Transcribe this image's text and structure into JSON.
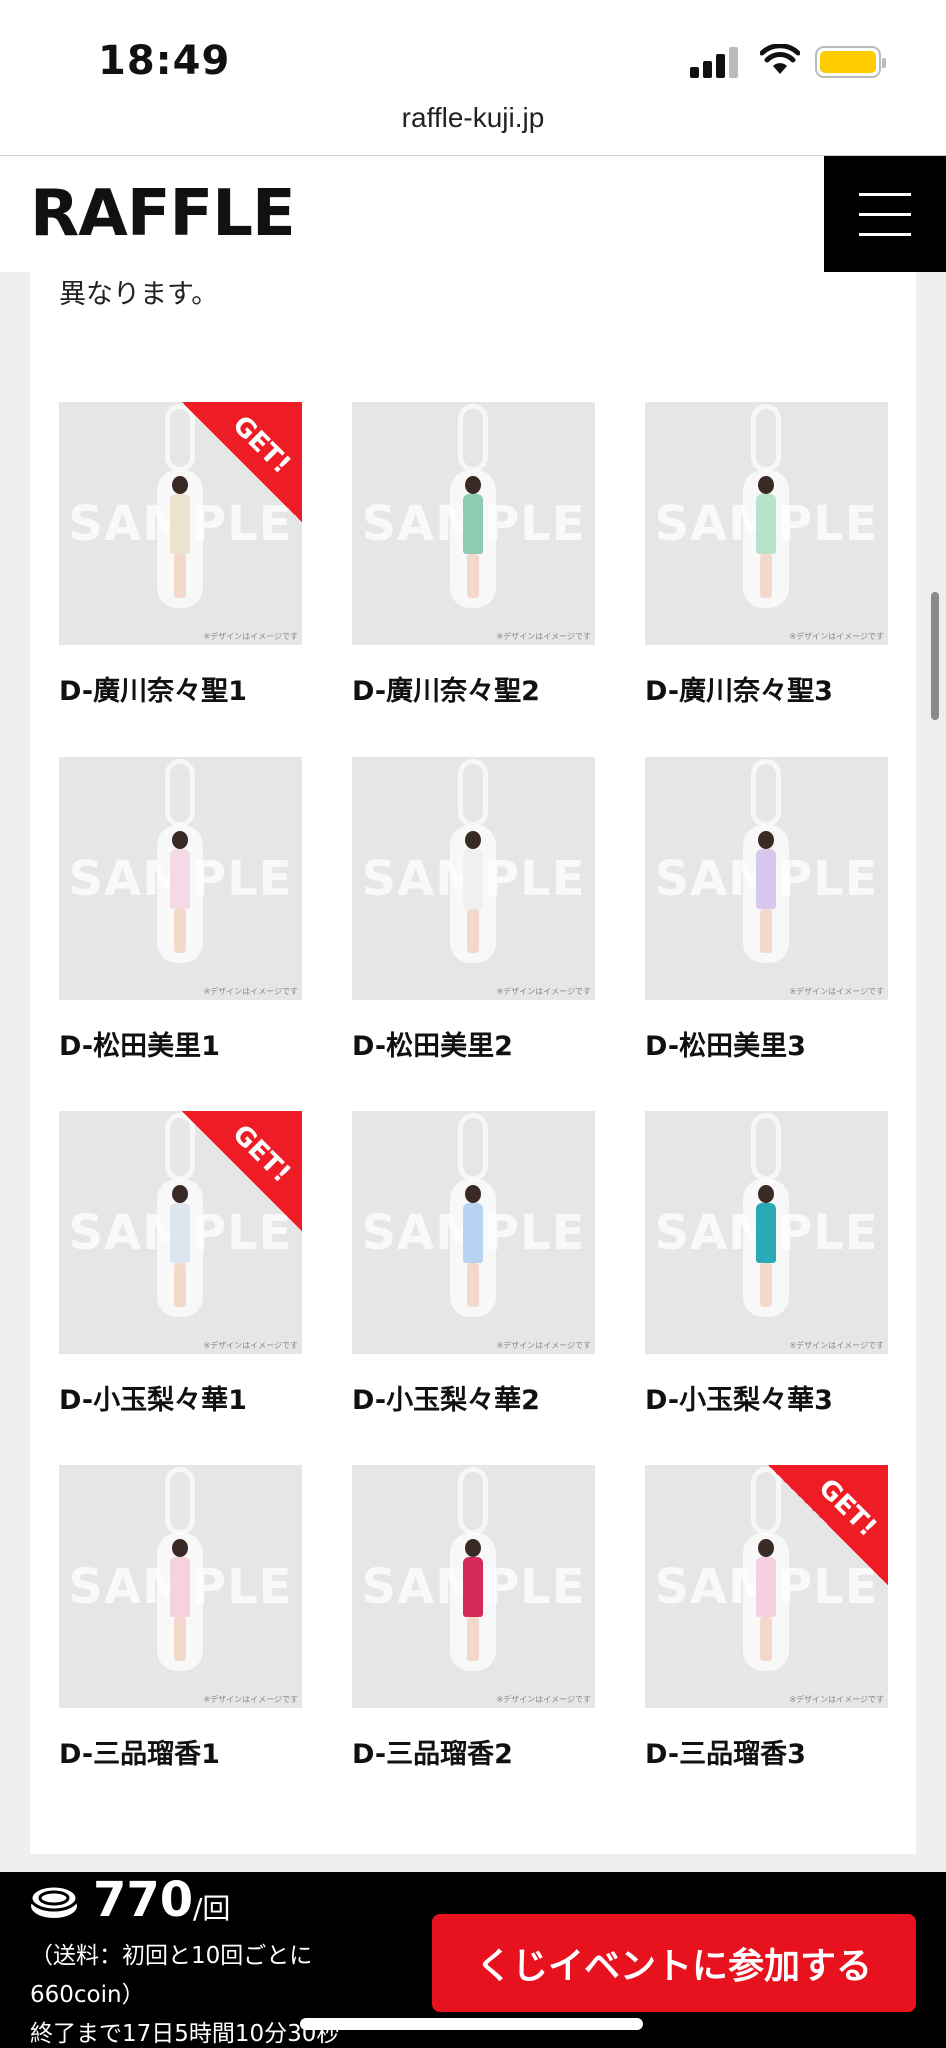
{
  "status_bar": {
    "time": "18:49",
    "url": "raffle-kuji.jp"
  },
  "header": {
    "logo_text": "RAFFLE",
    "menu_icon": "hamburger-icon"
  },
  "intro_text": "異なります。",
  "products": [
    {
      "label": "D-廣川奈々聖1",
      "get": true,
      "outfit": "#e9e3cf"
    },
    {
      "label": "D-廣川奈々聖2",
      "get": false,
      "outfit": "#8fcbb3"
    },
    {
      "label": "D-廣川奈々聖3",
      "get": false,
      "outfit": "#b6e3c9"
    },
    {
      "label": "D-松田美里1",
      "get": false,
      "outfit": "#f4d9e6"
    },
    {
      "label": "D-松田美里2",
      "get": false,
      "outfit": "#f0f0f0"
    },
    {
      "label": "D-松田美里3",
      "get": false,
      "outfit": "#d8c8ee"
    },
    {
      "label": "D-小玉梨々華1",
      "get": true,
      "outfit": "#dde6f0"
    },
    {
      "label": "D-小玉梨々華2",
      "get": false,
      "outfit": "#b7d3f2"
    },
    {
      "label": "D-小玉梨々華3",
      "get": false,
      "outfit": "#2aa9b7"
    },
    {
      "label": "D-三品瑠香1",
      "get": false,
      "outfit": "#f6d3dc"
    },
    {
      "label": "D-三品瑠香2",
      "get": false,
      "outfit": "#d32a5a"
    },
    {
      "label": "D-三品瑠香3",
      "get": true,
      "outfit": "#f6cfe0"
    }
  ],
  "thumb_text": {
    "sample": "SAMPLE",
    "note": "※デザインはイメージです",
    "badge": "GET!"
  },
  "footer": {
    "price": "770",
    "per": "/回",
    "shipping_line1": "（送料：初回と10回ごとに",
    "shipping_line2": "660coin）",
    "ends": "終了まで17日5時間10分30秒",
    "join_label": "くじイベントに参加する",
    "coin_icon": "coin-icon"
  },
  "colors": {
    "accent_red": "#e8121e",
    "badge_red": "#ee1c25"
  }
}
